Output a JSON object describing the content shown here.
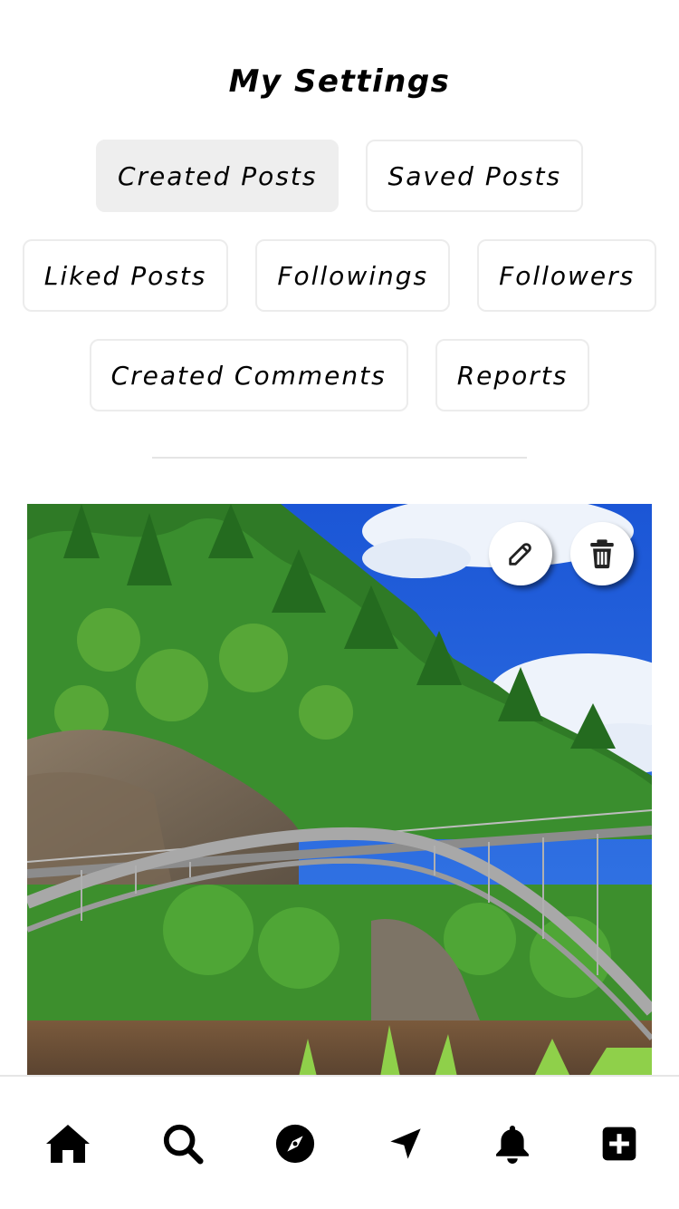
{
  "header": {
    "title": "My Settings"
  },
  "tabs": [
    {
      "label": "Created Posts",
      "active": true
    },
    {
      "label": "Saved Posts",
      "active": false
    },
    {
      "label": "Liked Posts",
      "active": false
    },
    {
      "label": "Followings",
      "active": false
    },
    {
      "label": "Followers",
      "active": false
    },
    {
      "label": "Created Comments",
      "active": false
    },
    {
      "label": "Reports",
      "active": false
    }
  ],
  "post": {
    "image": "bridge-over-river-photo",
    "actions": [
      {
        "icon": "edit-icon"
      },
      {
        "icon": "trash-icon"
      }
    ]
  },
  "nav": {
    "items": [
      {
        "icon": "home-icon"
      },
      {
        "icon": "search-icon"
      },
      {
        "icon": "compass-icon"
      },
      {
        "icon": "location-arrow-icon"
      },
      {
        "icon": "bell-icon"
      },
      {
        "icon": "plus-square-icon"
      }
    ]
  },
  "colors": {
    "active_tab_bg": "#eeeeee",
    "tab_border": "#ececec",
    "sky": "#1f5fd8",
    "forest": "#2f7f2a",
    "bridge": "#9a9a9a",
    "river": "#6b4e34"
  }
}
